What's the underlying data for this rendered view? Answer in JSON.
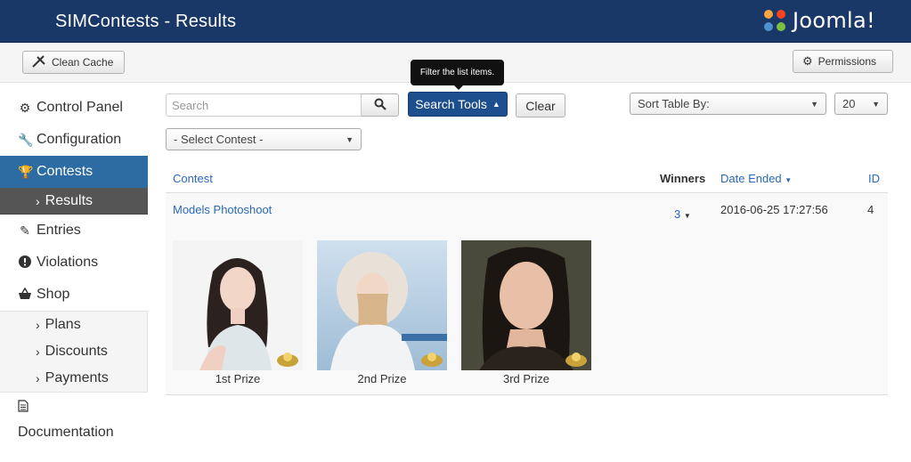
{
  "header": {
    "title": "SIMContests - Results",
    "brand": "Joomla!"
  },
  "toolbar": {
    "clean_cache": "Clean Cache",
    "permissions": "Permissions"
  },
  "tooltip": "Filter the list items.",
  "sidebar": {
    "items": [
      {
        "label": "Control Panel",
        "icon": "cogs-icon"
      },
      {
        "label": "Configuration",
        "icon": "wrench-icon"
      },
      {
        "label": "Contests",
        "icon": "trophy-icon",
        "active": true
      },
      {
        "label": "Results",
        "sub": true,
        "active": true
      },
      {
        "label": "Entries",
        "icon": "edit-icon"
      },
      {
        "label": "Violations",
        "icon": "warning-icon"
      },
      {
        "label": "Shop",
        "icon": "basket-icon"
      },
      {
        "label": "Plans",
        "sub": true
      },
      {
        "label": "Discounts",
        "sub": true
      },
      {
        "label": "Payments",
        "sub": true
      },
      {
        "label": "Documentation",
        "icon": "document-icon"
      }
    ]
  },
  "filters": {
    "search_placeholder": "Search",
    "search_tools": "Search Tools",
    "clear": "Clear",
    "sort_label": "Sort Table By:",
    "limit": "20",
    "contest_select": "- Select Contest -"
  },
  "table": {
    "headers": {
      "contest": "Contest",
      "winners": "Winners",
      "date_ended": "Date Ended",
      "id": "ID"
    },
    "rows": [
      {
        "contest": "Models Photoshoot",
        "winners": "3",
        "date_ended": "2016-06-25 17:27:56",
        "id": "4",
        "prizes": [
          {
            "caption": "1st Prize"
          },
          {
            "caption": "2nd Prize"
          },
          {
            "caption": "3rd Prize"
          }
        ]
      }
    ]
  },
  "colors": {
    "header_bg": "#1a3867",
    "accent": "#2d6ca2",
    "link": "#2a69b8"
  }
}
